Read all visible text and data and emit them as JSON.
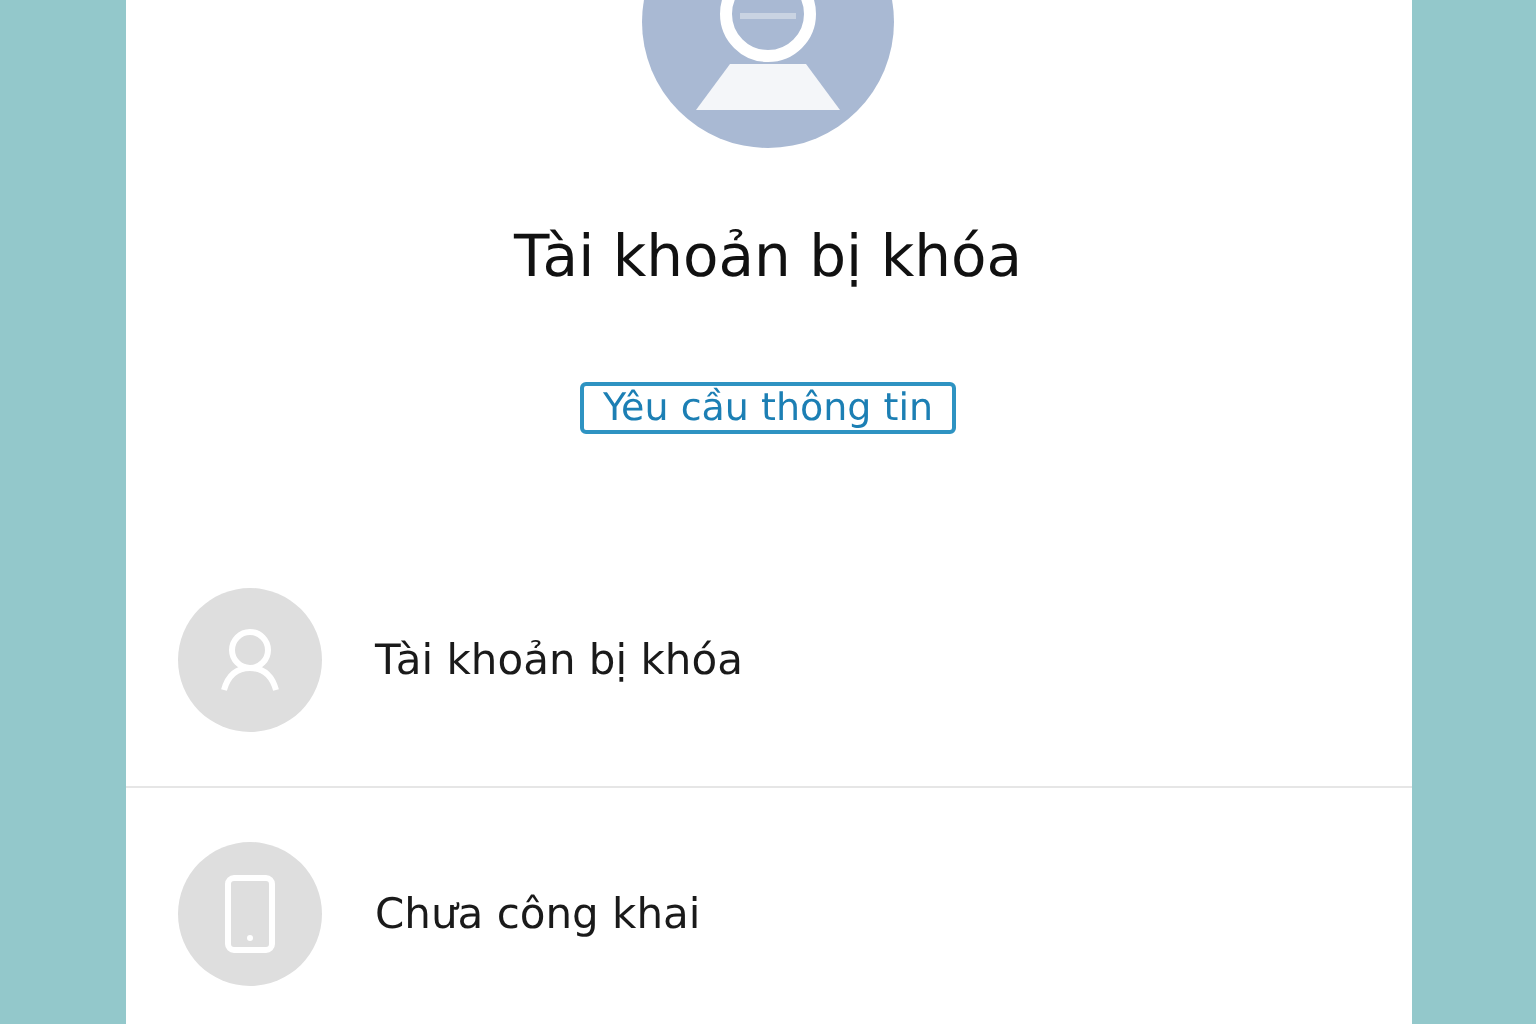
{
  "profile": {
    "title": "Tài khoản bị khóa",
    "button": "Yêu cầu thông tin"
  },
  "items": [
    {
      "kind": "person",
      "label": "Tài khoản bị khóa"
    },
    {
      "kind": "phone",
      "label": "Chưa công khai"
    }
  ]
}
